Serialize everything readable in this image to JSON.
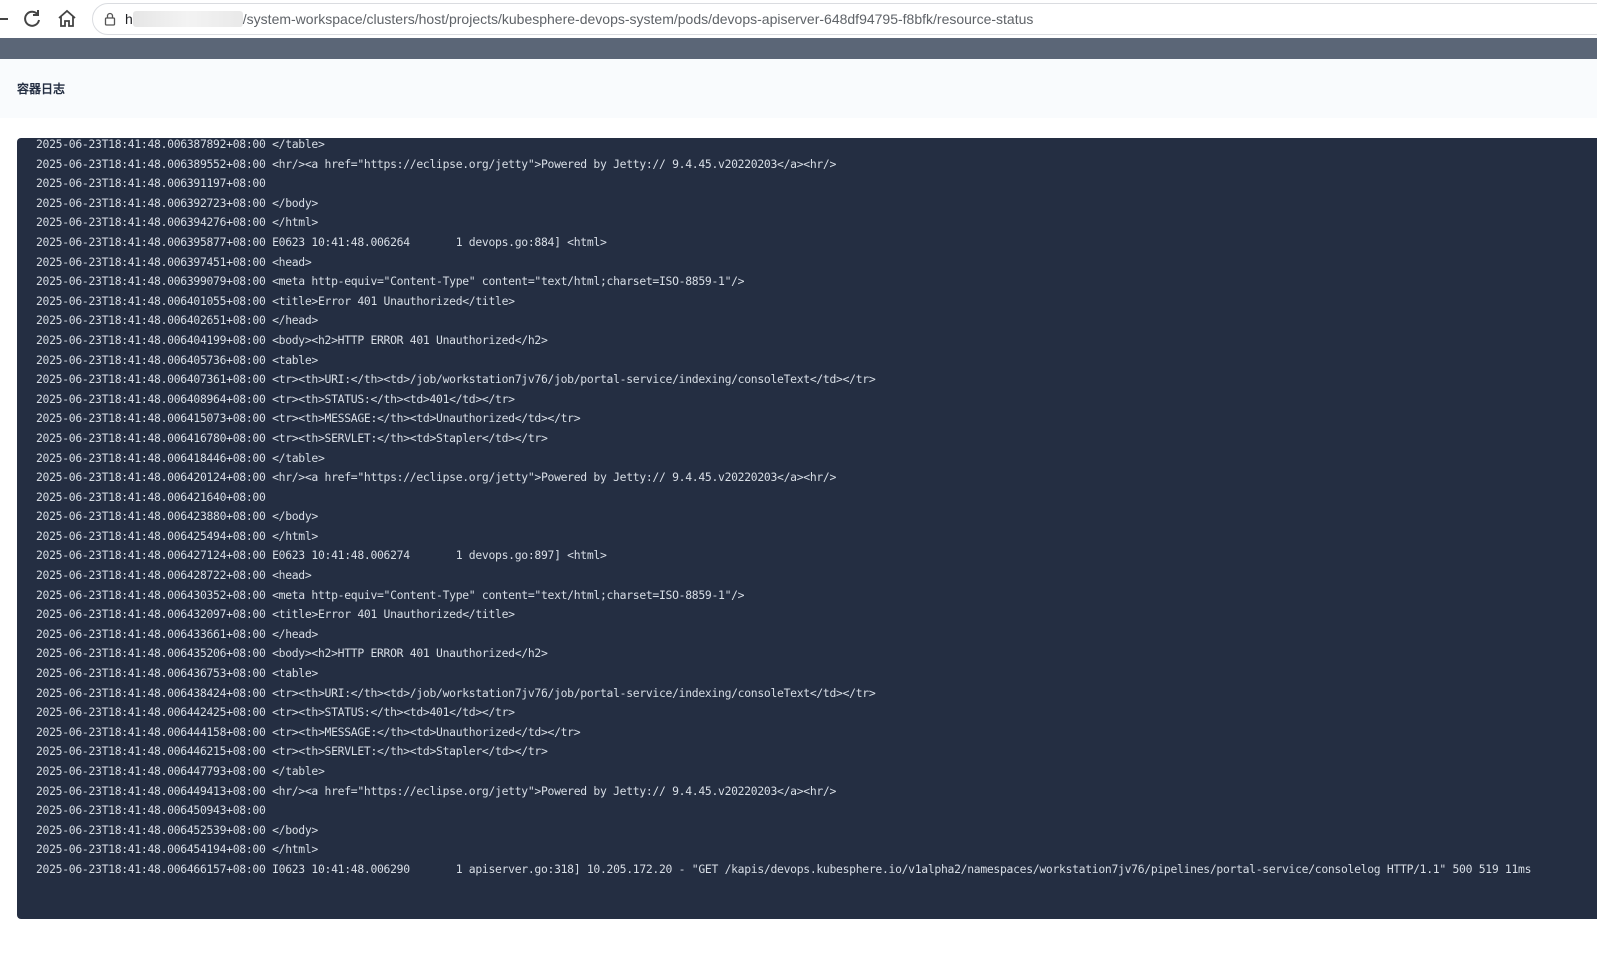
{
  "browser": {
    "url_prefix": "h",
    "url_rest": "/system-workspace/clusters/host/projects/kubesphere-devops-system/pods/devops-apiserver-648df94795-f8bfk/resource-status"
  },
  "page": {
    "title": "容器日志"
  },
  "log": {
    "lines": [
      "2025-06-23T18:41:48.006387892+08:00 </table>",
      "2025-06-23T18:41:48.006389552+08:00 <hr/><a href=\"https://eclipse.org/jetty\">Powered by Jetty:// 9.4.45.v20220203</a><hr/>",
      "2025-06-23T18:41:48.006391197+08:00",
      "2025-06-23T18:41:48.006392723+08:00 </body>",
      "2025-06-23T18:41:48.006394276+08:00 </html>",
      "2025-06-23T18:41:48.006395877+08:00 E0623 10:41:48.006264       1 devops.go:884] <html>",
      "2025-06-23T18:41:48.006397451+08:00 <head>",
      "2025-06-23T18:41:48.006399079+08:00 <meta http-equiv=\"Content-Type\" content=\"text/html;charset=ISO-8859-1\"/>",
      "2025-06-23T18:41:48.006401055+08:00 <title>Error 401 Unauthorized</title>",
      "2025-06-23T18:41:48.006402651+08:00 </head>",
      "2025-06-23T18:41:48.006404199+08:00 <body><h2>HTTP ERROR 401 Unauthorized</h2>",
      "2025-06-23T18:41:48.006405736+08:00 <table>",
      "2025-06-23T18:41:48.006407361+08:00 <tr><th>URI:</th><td>/job/workstation7jv76/job/portal-service/indexing/consoleText</td></tr>",
      "2025-06-23T18:41:48.006408964+08:00 <tr><th>STATUS:</th><td>401</td></tr>",
      "2025-06-23T18:41:48.006415073+08:00 <tr><th>MESSAGE:</th><td>Unauthorized</td></tr>",
      "2025-06-23T18:41:48.006416780+08:00 <tr><th>SERVLET:</th><td>Stapler</td></tr>",
      "2025-06-23T18:41:48.006418446+08:00 </table>",
      "2025-06-23T18:41:48.006420124+08:00 <hr/><a href=\"https://eclipse.org/jetty\">Powered by Jetty:// 9.4.45.v20220203</a><hr/>",
      "2025-06-23T18:41:48.006421640+08:00",
      "2025-06-23T18:41:48.006423880+08:00 </body>",
      "2025-06-23T18:41:48.006425494+08:00 </html>",
      "2025-06-23T18:41:48.006427124+08:00 E0623 10:41:48.006274       1 devops.go:897] <html>",
      "2025-06-23T18:41:48.006428722+08:00 <head>",
      "2025-06-23T18:41:48.006430352+08:00 <meta http-equiv=\"Content-Type\" content=\"text/html;charset=ISO-8859-1\"/>",
      "2025-06-23T18:41:48.006432097+08:00 <title>Error 401 Unauthorized</title>",
      "2025-06-23T18:41:48.006433661+08:00 </head>",
      "2025-06-23T18:41:48.006435206+08:00 <body><h2>HTTP ERROR 401 Unauthorized</h2>",
      "2025-06-23T18:41:48.006436753+08:00 <table>",
      "2025-06-23T18:41:48.006438424+08:00 <tr><th>URI:</th><td>/job/workstation7jv76/job/portal-service/indexing/consoleText</td></tr>",
      "2025-06-23T18:41:48.006442425+08:00 <tr><th>STATUS:</th><td>401</td></tr>",
      "2025-06-23T18:41:48.006444158+08:00 <tr><th>MESSAGE:</th><td>Unauthorized</td></tr>",
      "2025-06-23T18:41:48.006446215+08:00 <tr><th>SERVLET:</th><td>Stapler</td></tr>",
      "2025-06-23T18:41:48.006447793+08:00 </table>",
      "2025-06-23T18:41:48.006449413+08:00 <hr/><a href=\"https://eclipse.org/jetty\">Powered by Jetty:// 9.4.45.v20220203</a><hr/>",
      "2025-06-23T18:41:48.006450943+08:00",
      "2025-06-23T18:41:48.006452539+08:00 </body>",
      "2025-06-23T18:41:48.006454194+08:00 </html>",
      "2025-06-23T18:41:48.006466157+08:00 I0623 10:41:48.006290       1 apiserver.go:318] 10.205.172.20 - \"GET /kapis/devops.kubesphere.io/v1alpha2/namespaces/workstation7jv76/pipelines/portal-service/consolelog HTTP/1.1\" 500 519 11ms"
    ]
  },
  "icons": {
    "back": "back-arrow-icon",
    "reload": "reload-icon",
    "home": "home-icon",
    "lock": "lock-icon"
  },
  "colors": {
    "log_background": "#242e42",
    "log_text": "#d8dee6",
    "top_strip": "#5b6677",
    "header_bg": "#f9fbfd"
  }
}
